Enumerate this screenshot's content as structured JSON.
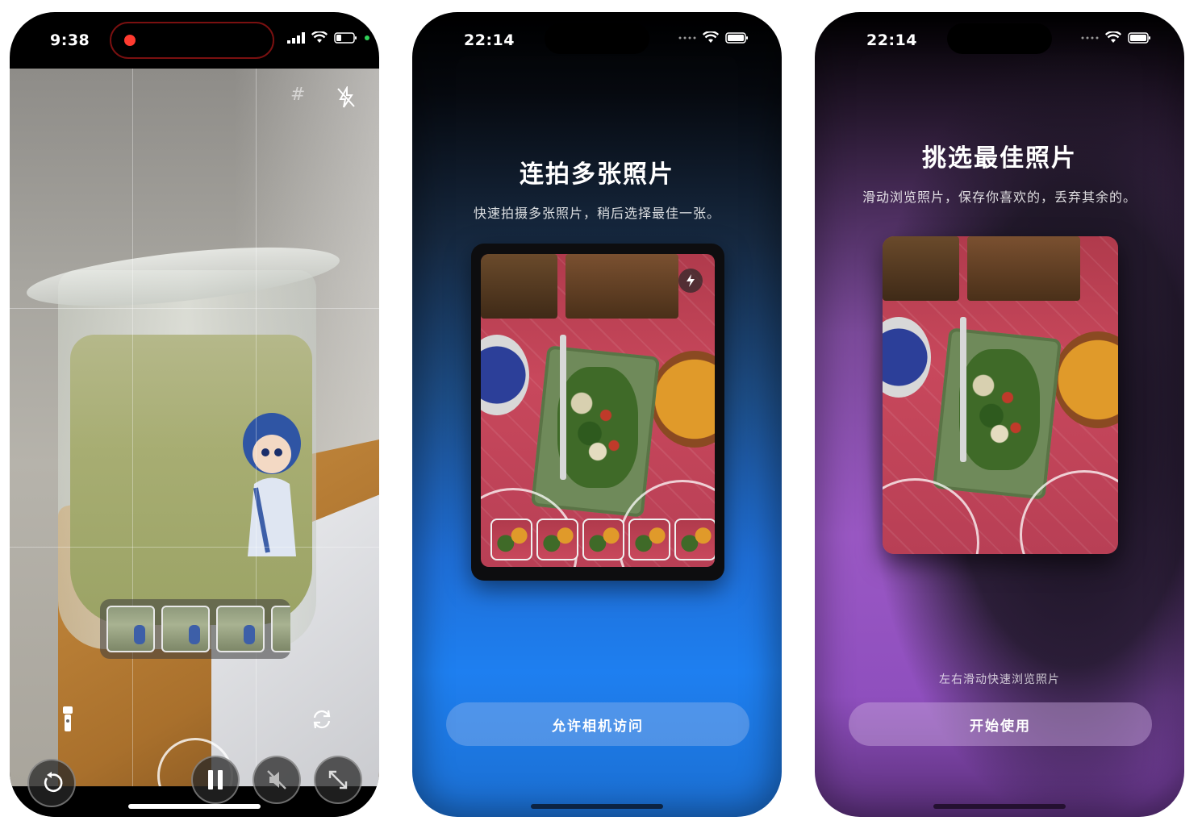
{
  "screens": [
    {
      "status": {
        "time": "9:38"
      },
      "camera": {
        "grid_icon": "grid-hash-icon",
        "flash_icon": "flash-off-icon",
        "flashlight_icon": "flashlight-icon",
        "flip_icon": "camera-flip-icon",
        "controls": [
          "reset-icon",
          "pause-icon",
          "mute-icon",
          "expand-icon"
        ]
      }
    },
    {
      "status": {
        "time": "22:14"
      },
      "title": "连拍多张照片",
      "subtitle": "快速拍摄多张照片，稍后选择最佳一张。",
      "button": "允许相机访问"
    },
    {
      "status": {
        "time": "22:14"
      },
      "title": "挑选最佳照片",
      "subtitle": "滑动浏览照片，保存你喜欢的，丢弃其余的。",
      "hint": "左右滑动快速浏览照片",
      "button": "开始使用"
    }
  ],
  "colors": {
    "record_dot": "#ff3b30",
    "blue_accent": "#1e7ff0",
    "purple_accent": "#9a58c4"
  }
}
